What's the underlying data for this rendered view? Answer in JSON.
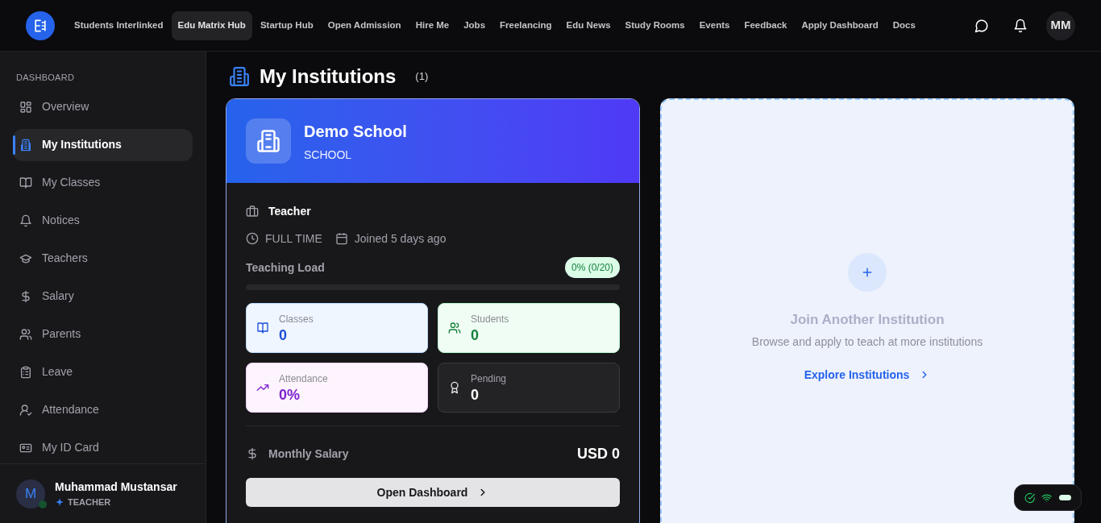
{
  "nav": {
    "items": [
      {
        "label": "Students Interlinked",
        "selected": false
      },
      {
        "label": "Edu Matrix Hub",
        "selected": true
      },
      {
        "label": "Startup Hub",
        "selected": false
      },
      {
        "label": "Open Admission",
        "selected": false
      },
      {
        "label": "Hire Me",
        "selected": false
      },
      {
        "label": "Jobs",
        "selected": false
      },
      {
        "label": "Freelancing",
        "selected": false
      },
      {
        "label": "Edu News",
        "selected": false
      },
      {
        "label": "Study Rooms",
        "selected": false
      },
      {
        "label": "Events",
        "selected": false
      },
      {
        "label": "Feedback",
        "selected": false
      },
      {
        "label": "Apply Dashboard",
        "selected": false
      },
      {
        "label": "Docs",
        "selected": false
      }
    ],
    "avatar": "MM"
  },
  "sidebar": {
    "section": "DASHBOARD",
    "items": [
      {
        "label": "Overview",
        "selected": false
      },
      {
        "label": "My Institutions",
        "selected": true
      },
      {
        "label": "My Classes",
        "selected": false
      },
      {
        "label": "Notices",
        "selected": false
      },
      {
        "label": "Teachers",
        "selected": false
      },
      {
        "label": "Salary",
        "selected": false
      },
      {
        "label": "Parents",
        "selected": false
      },
      {
        "label": "Leave",
        "selected": false
      },
      {
        "label": "Attendance",
        "selected": false
      },
      {
        "label": "My ID Card",
        "selected": false
      }
    ],
    "user": {
      "initial": "M",
      "name": "Muhammad Mustansar",
      "role": "TEACHER"
    }
  },
  "page": {
    "title": "My Institutions",
    "count": "(1)"
  },
  "institution": {
    "name": "Demo School",
    "type": "SCHOOL",
    "role": "Teacher",
    "employment": "FULL TIME",
    "joined": "Joined 5 days ago",
    "load_label": "Teaching Load",
    "load_badge": "0% (0/20)",
    "level": 0,
    "stats": [
      {
        "label": "Classes",
        "value": "0",
        "kind": "blue"
      },
      {
        "label": "Students",
        "value": "0",
        "kind": "green"
      },
      {
        "label": "Attendance",
        "value": "0%",
        "kind": "purple"
      },
      {
        "label": "Pending",
        "value": "0",
        "kind": "plain"
      }
    ],
    "salary_label": "Monthly Salary",
    "salary": "USD 0",
    "button": "Open Dashboard"
  },
  "join": {
    "title": "Join Another Institution",
    "text": "Browse and apply to teach at more institutions",
    "link": "Explore Institutions"
  }
}
